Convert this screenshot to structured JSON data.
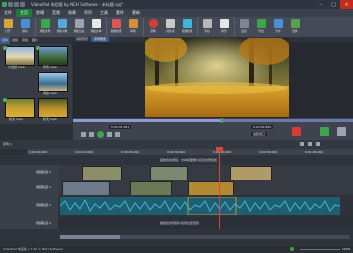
{
  "window": {
    "title": "VideoPad 电话版 by NCH Software - 未标题.vpj*",
    "controls": [
      "minimize",
      "maximize",
      "close"
    ]
  },
  "menu": {
    "items": [
      "文件",
      "主页",
      "剪辑",
      "音频",
      "效果",
      "序列",
      "工具",
      "套件",
      "更新"
    ],
    "active_index": 1
  },
  "toolbar": {
    "items": [
      {
        "label": "打开",
        "icon": "open-icon"
      },
      {
        "label": "保存",
        "icon": "save-icon"
      },
      {
        "label": "添加文件",
        "icon": "add-file-icon"
      },
      {
        "label": "添加对象",
        "icon": "add-objects-icon"
      },
      {
        "label": "添加空白",
        "icon": "add-blank-icon"
      },
      {
        "label": "添加文本",
        "icon": "add-text-icon"
      },
      {
        "label": "视频效果",
        "icon": "video-effects-icon"
      },
      {
        "label": "转场",
        "icon": "transition-icon"
      },
      {
        "label": "录制",
        "icon": "record-icon"
      },
      {
        "label": "画外音",
        "icon": "narrate-icon"
      },
      {
        "label": "音频效果",
        "icon": "audio-effects-icon"
      },
      {
        "label": "剪切",
        "icon": "scissors-icon"
      },
      {
        "label": "拆分",
        "icon": "split-icon"
      },
      {
        "label": "设置",
        "icon": "settings-icon"
      },
      {
        "label": "导出",
        "icon": "export-icon"
      },
      {
        "label": "分享",
        "icon": "share-icon"
      },
      {
        "label": "套件",
        "icon": "suite-icon"
      }
    ]
  },
  "bins": {
    "tabs": [
      "媒体",
      "视频",
      "音频",
      "图片"
    ],
    "files": [
      {
        "name": "大自然.mp4",
        "checked": true
      },
      {
        "name": "风景.mp4",
        "checked": true
      },
      {
        "name": "海边.mp4",
        "checked": false
      },
      {
        "name": "秋天.mp4",
        "checked": true
      },
      {
        "name": "秋天.mp4",
        "checked": false
      }
    ]
  },
  "preview": {
    "tabs": [
      "剪辑预览",
      "序列预览"
    ],
    "active_tab": 1,
    "timecode": "0:00:32.301",
    "end_timecode": "0:00:59.950",
    "zoom": "适配窗口",
    "progress_fraction": 0.53
  },
  "timeline": {
    "tab_label": "序列 1",
    "ruler_labels": [
      "0:00:00.000",
      "0:00:10.000",
      "0:00:20.000",
      "0:00:30.000",
      "0:00:40.000",
      "0:00:50.000",
      "0:01:00.000"
    ],
    "drop_video_hint": "拖放您的视频、文本和图像片段到这里叠加",
    "drop_audio_hint": "拖放您的音频片段到这里混音",
    "tracks": [
      {
        "name": "视频轨道 1",
        "kind": "video"
      },
      {
        "name": "视频轨道 2",
        "kind": "video"
      },
      {
        "name": "音频轨道 1",
        "kind": "audio"
      },
      {
        "name": "音频轨道 2",
        "kind": "audio"
      }
    ]
  },
  "status": {
    "text": "VideoPad 电话版 v 7.30 © NCH Software",
    "zoom_level": "100%"
  },
  "colors": {
    "accent_green": "#1f7a3a",
    "record_red": "#d93b3b",
    "waveform_cyan": "#3fb6d3",
    "playhead_red": "#e14040"
  }
}
